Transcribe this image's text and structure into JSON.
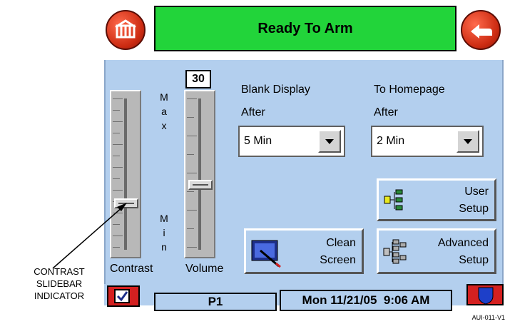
{
  "header": {
    "title": "Ready To Arm"
  },
  "contrast": {
    "label": "Contrast",
    "max_letters": [
      "M",
      "a",
      "x"
    ],
    "min_letters": [
      "M",
      "i",
      "n"
    ]
  },
  "volume": {
    "label": "Volume",
    "value": "30"
  },
  "blank_display": {
    "label_line1": "Blank Display",
    "label_line2": "After",
    "selected": "5 Min"
  },
  "to_homepage": {
    "label_line1": "To Homepage",
    "label_line2": "After",
    "selected": "2 Min"
  },
  "buttons": {
    "user_setup": {
      "line1": "User",
      "line2": "Setup"
    },
    "clean_screen": {
      "line1": "Clean",
      "line2": "Screen"
    },
    "advanced_setup": {
      "line1": "Advanced",
      "line2": "Setup"
    }
  },
  "status": {
    "partition": "P1",
    "datetime": "Mon 11/21/05  9:06 AM"
  },
  "annotation": {
    "line1": "CONTRAST",
    "line2": "SLIDEBAR",
    "line3": "INDICATOR"
  },
  "figure_code": "AUI-011-V1",
  "colors": {
    "panel": "#b3cfee",
    "header": "#22d43a",
    "round_button": "#cc2b12"
  }
}
